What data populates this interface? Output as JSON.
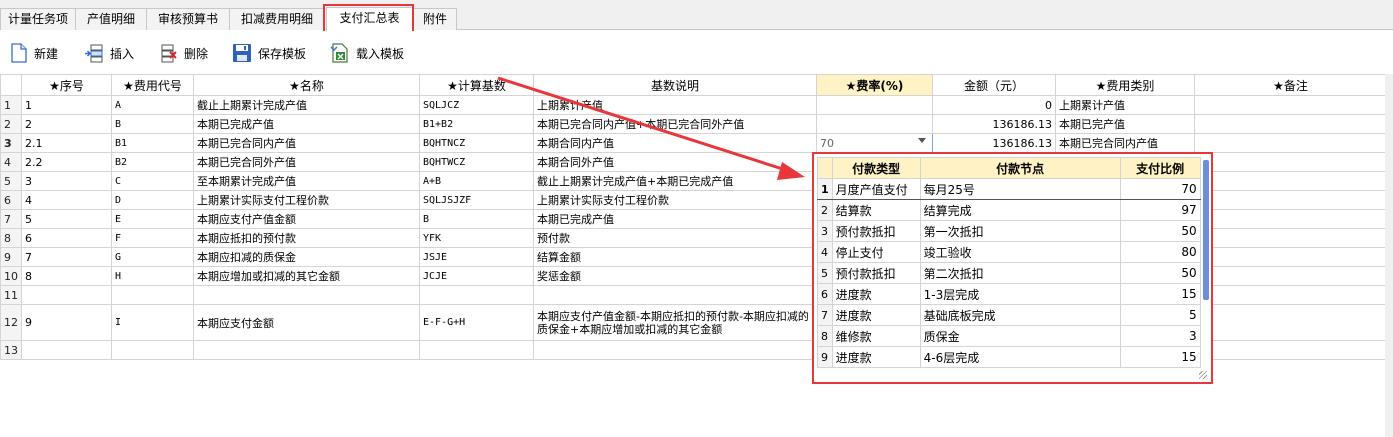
{
  "tabs": [
    {
      "label": "计量任务项",
      "active": false
    },
    {
      "label": "产值明细",
      "active": false
    },
    {
      "label": "审核预算书",
      "active": false
    },
    {
      "label": "扣减费用明细",
      "active": false
    },
    {
      "label": "支付汇总表",
      "active": true
    },
    {
      "label": "附件",
      "active": false
    }
  ],
  "toolbar": {
    "new_label": "新建",
    "insert_label": "插入",
    "delete_label": "删除",
    "save_template_label": "保存模板",
    "load_template_label": "载入模板"
  },
  "grid": {
    "headers": [
      "★序号",
      "★费用代号",
      "★名称",
      "★计算基数",
      "基数说明",
      "★费率(%)",
      "金额（元）",
      "★费用类别",
      "★备注"
    ],
    "rows": [
      {
        "rn": "1",
        "seq": "1",
        "code": "A",
        "name": "截止上期累计完成产值",
        "base": "SQLJCZ",
        "desc": "上期累计产值",
        "rate": "",
        "amount": "0",
        "category": "上期累计产值",
        "note": ""
      },
      {
        "rn": "2",
        "seq": "2",
        "code": "B",
        "name": "本期已完成产值",
        "base": "B1+B2",
        "desc": "本期已完合同内产值+本期已完合同外产值",
        "rate": "",
        "amount": "136186.13",
        "category": "本期已完产值",
        "note": ""
      },
      {
        "rn": "3",
        "seq": "2.1",
        "code": "B1",
        "name": "本期已完合同内产值",
        "base": "BQHTNCZ",
        "desc": "本期合同内产值",
        "rate": "70",
        "amount": "136186.13",
        "category": "本期已完合同内产值",
        "note": ""
      },
      {
        "rn": "4",
        "seq": "2.2",
        "code": "B2",
        "name": "本期已完合同外产值",
        "base": "BQHTWCZ",
        "desc": "本期合同外产值",
        "rate": "",
        "amount": "",
        "category": "",
        "note": ""
      },
      {
        "rn": "5",
        "seq": "3",
        "code": "C",
        "name": "至本期累计完成产值",
        "base": "A+B",
        "desc": "截止上期累计完成产值+本期已完成产值",
        "rate": "",
        "amount": "",
        "category": "",
        "note": ""
      },
      {
        "rn": "6",
        "seq": "4",
        "code": "D",
        "name": "上期累计实际支付工程价款",
        "base": "SQLJSJZF",
        "desc": "上期累计实际支付工程价款",
        "rate": "",
        "amount": "",
        "category": "",
        "note": ""
      },
      {
        "rn": "7",
        "seq": "5",
        "code": "E",
        "name": "本期应支付产值金额",
        "base": "B",
        "desc": "本期已完成产值",
        "rate": "",
        "amount": "",
        "category": "",
        "note": ""
      },
      {
        "rn": "8",
        "seq": "6",
        "code": "F",
        "name": "本期应抵扣的预付款",
        "base": "YFK",
        "desc": "预付款",
        "rate": "",
        "amount": "",
        "category": "",
        "note": ""
      },
      {
        "rn": "9",
        "seq": "7",
        "code": "G",
        "name": "本期应扣减的质保金",
        "base": "JSJE",
        "desc": "结算金额",
        "rate": "",
        "amount": "",
        "category": "",
        "note": ""
      },
      {
        "rn": "10",
        "seq": "8",
        "code": "H",
        "name": "本期应增加或扣减的其它金额",
        "base": "JCJE",
        "desc": "奖惩金额",
        "rate": "",
        "amount": "",
        "category": "",
        "note": ""
      },
      {
        "rn": "11",
        "seq": "",
        "code": "",
        "name": "",
        "base": "",
        "desc": "",
        "rate": "",
        "amount": "",
        "category": "",
        "note": ""
      },
      {
        "rn": "12",
        "seq": "9",
        "code": "I",
        "name": "本期应支付金额",
        "base": "E-F-G+H",
        "desc": "本期应支付产值金额-本期应抵扣的预付款-本期应扣减的质保金+本期应增加或扣减的其它金额",
        "rate": "",
        "amount": "",
        "category": "",
        "note": ""
      },
      {
        "rn": "13",
        "seq": "",
        "code": "",
        "name": "",
        "base": "",
        "desc": "",
        "rate": "",
        "amount": "",
        "category": "",
        "note": ""
      }
    ]
  },
  "popup": {
    "headers": [
      "付款类型",
      "付款节点",
      "支付比例"
    ],
    "rows": [
      {
        "rn": "1",
        "type": "月度产值支付",
        "node": "每月25号",
        "ratio": "70"
      },
      {
        "rn": "2",
        "type": "结算款",
        "node": "结算完成",
        "ratio": "97"
      },
      {
        "rn": "3",
        "type": "预付款抵扣",
        "node": "第一次抵扣",
        "ratio": "50"
      },
      {
        "rn": "4",
        "type": "停止支付",
        "node": "竣工验收",
        "ratio": "80"
      },
      {
        "rn": "5",
        "type": "预付款抵扣",
        "node": "第二次抵扣",
        "ratio": "50"
      },
      {
        "rn": "6",
        "type": "进度款",
        "node": "1-3层完成",
        "ratio": "15"
      },
      {
        "rn": "7",
        "type": "进度款",
        "node": "基础底板完成",
        "ratio": "5"
      },
      {
        "rn": "8",
        "type": "维修款",
        "node": "质保金",
        "ratio": "3"
      },
      {
        "rn": "9",
        "type": "进度款",
        "node": "4-6层完成",
        "ratio": "15"
      }
    ]
  },
  "colors": {
    "highlight": "#e8363b",
    "rate_header_bg": "#fff2c4",
    "scrollbar": "#6b8fd8"
  }
}
